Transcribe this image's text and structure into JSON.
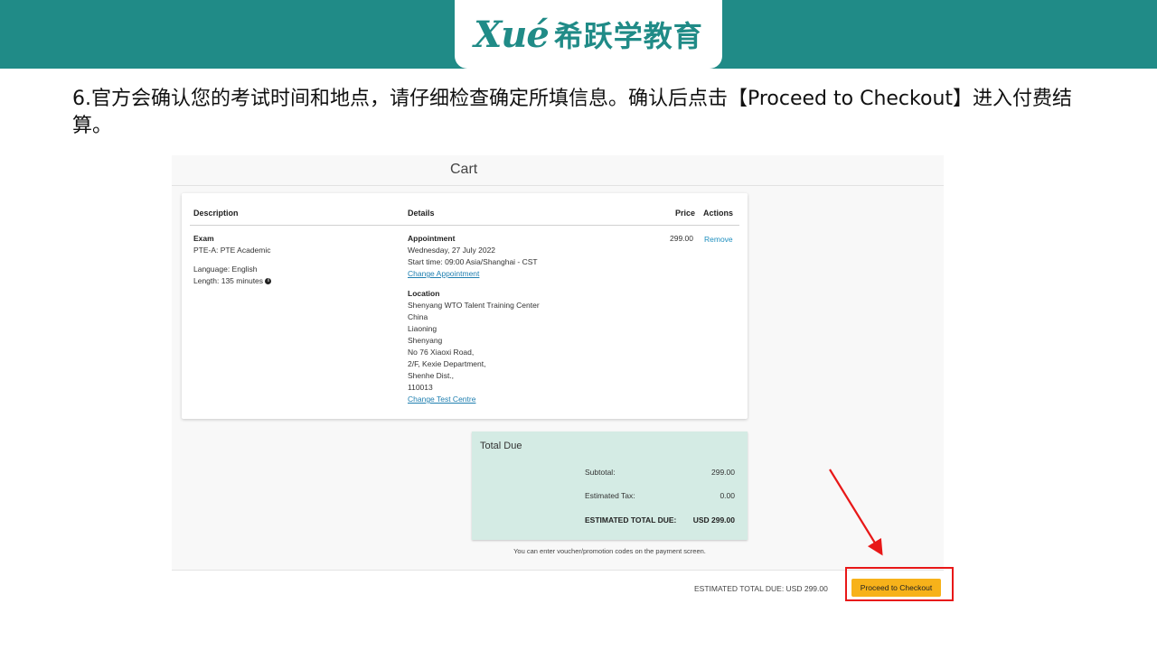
{
  "header": {
    "logo_mark": "Xué",
    "logo_text": "希跃学教育",
    "brand_color": "#208b87"
  },
  "instruction": "6.官方会确认您的考试时间和地点，请仔细检查确定所填信息。确认后点击【Proceed to Checkout】进入付费结算。",
  "cart": {
    "title": "Cart",
    "columns": {
      "description": "Description",
      "details": "Details",
      "price": "Price",
      "actions": "Actions"
    },
    "item": {
      "type_label": "Exam",
      "exam_name": "PTE-A: PTE Academic",
      "language": "Language: English",
      "length": "Length: 135 minutes",
      "appointment_label": "Appointment",
      "appointment_date": "Wednesday, 27 July 2022",
      "start_time": "Start time: 09:00 Asia/Shanghai - CST",
      "change_appointment": "Change Appointment",
      "location_label": "Location",
      "location_lines": [
        "Shenyang WTO Talent Training Center",
        "China",
        "Liaoning",
        "Shenyang",
        "No 76 Xiaoxi Road,",
        "2/F, Kexie Department,",
        "Shenhe Dist.,",
        "110013"
      ],
      "change_test_centre": "Change Test Centre",
      "price": "299.00",
      "remove": "Remove"
    },
    "total": {
      "title": "Total Due",
      "subtotal_label": "Subtotal:",
      "subtotal_value": "299.00",
      "tax_label": "Estimated Tax:",
      "tax_value": "0.00",
      "est_total_label": "ESTIMATED TOTAL DUE:",
      "est_total_value": "USD 299.00"
    },
    "voucher_note": "You can enter voucher/promotion codes on the payment screen.",
    "bottom_total": "ESTIMATED TOTAL DUE: USD 299.00",
    "checkout_button": "Proceed to Checkout"
  },
  "annotation": {
    "highlight_color": "#e81818",
    "arrow_icon": "red-arrow-icon"
  }
}
